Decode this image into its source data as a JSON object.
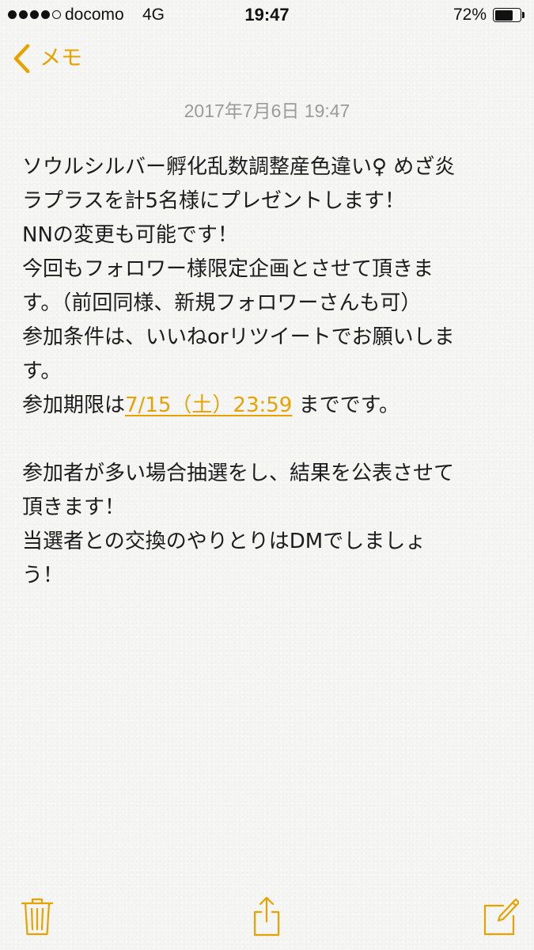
{
  "status_bar": {
    "carrier": "docomo",
    "network": "4G",
    "time": "19:47",
    "battery_percent_label": "72%",
    "battery_level": 0.72,
    "signal_bars_filled": 4,
    "signal_bars_total": 5
  },
  "nav": {
    "back_label": "メモ",
    "accent_color": "#e8a200"
  },
  "note": {
    "date": "2017年7月6日 19:47",
    "lines": [
      "ソウルシルバー孵化乱数調整産色違い♀ めざ炎",
      "ラプラスを計5名様にプレゼントします！",
      "NNの変更も可能です！",
      "今回もフォロワー様限定企画とさせて頂きま",
      "す。（前回同様、新規フォロワーさんも可）",
      "参加条件は、いいねorリツイートでお願いしま",
      "す。"
    ],
    "deadline_prefix": "参加期限は",
    "deadline_link": "7/15（土）23:59",
    "deadline_suffix": " までです。",
    "lines_after": [
      "参加者が多い場合抽選をし、結果を公表させて",
      "頂きます！",
      "当選者との交換のやりとりはDMでしましょ",
      "う！"
    ]
  },
  "toolbar": {
    "icons": [
      "trash-icon",
      "share-icon",
      "compose-icon"
    ]
  }
}
